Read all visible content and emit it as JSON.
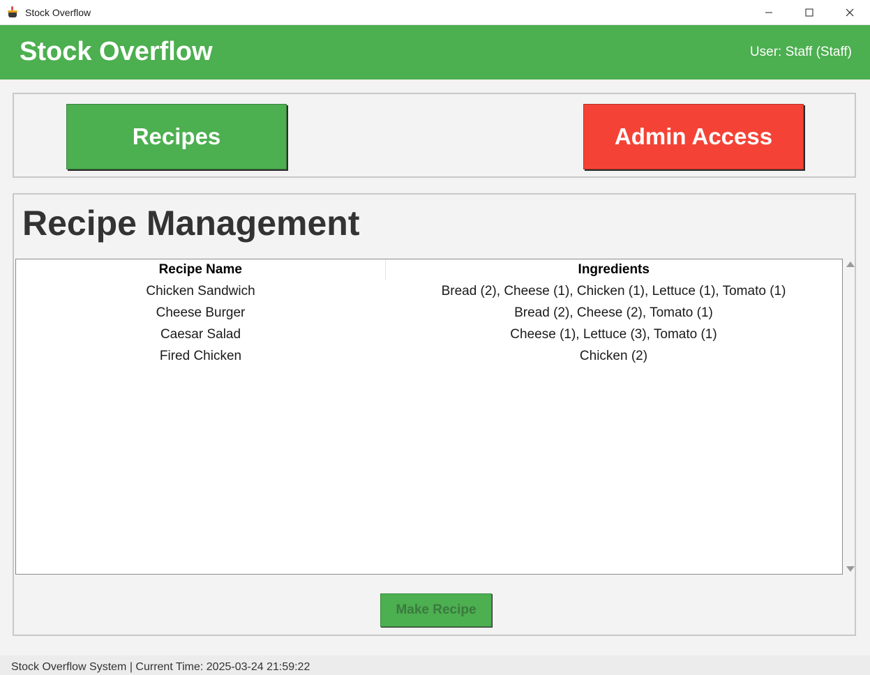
{
  "window": {
    "title": "Stock Overflow",
    "controls": {
      "minimize": "—",
      "maximize": "☐",
      "close": "✕"
    }
  },
  "header": {
    "brand": "Stock Overflow",
    "user": "User: Staff (Staff)"
  },
  "nav": {
    "recipes_label": "Recipes",
    "admin_label": "Admin Access"
  },
  "main": {
    "title": "Recipe Management",
    "table": {
      "headers": [
        "Recipe Name",
        "Ingredients"
      ],
      "rows": [
        {
          "name": "Chicken Sandwich",
          "ingredients": "Bread (2), Cheese (1), Chicken (1), Lettuce (1), Tomato (1)"
        },
        {
          "name": "Cheese Burger",
          "ingredients": "Bread (2), Cheese (2), Tomato (1)"
        },
        {
          "name": "Caesar Salad",
          "ingredients": "Cheese (1), Lettuce (3), Tomato (1)"
        },
        {
          "name": "Fired Chicken",
          "ingredients": "Chicken (2)"
        }
      ]
    },
    "make_recipe_label": "Make Recipe"
  },
  "status": {
    "text": "Stock Overflow System | Current Time: 2025-03-24 21:59:22"
  },
  "colors": {
    "primary_green": "#4caf50",
    "admin_red": "#f44336"
  }
}
